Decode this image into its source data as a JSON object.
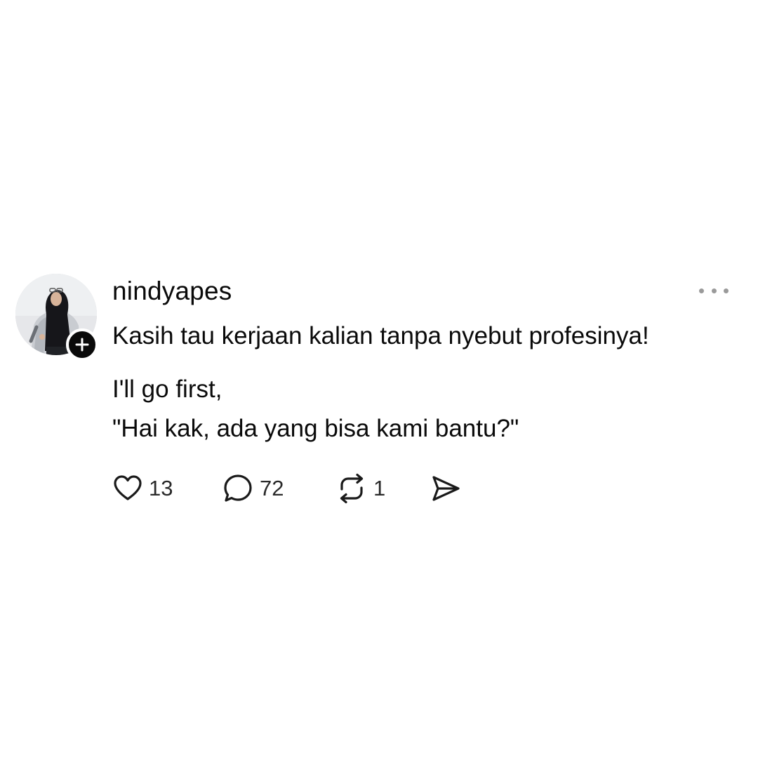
{
  "post": {
    "username": "nindyapes",
    "lines": [
      "Kasih tau kerjaan kalian tanpa nyebut profesinya!",
      "I'll go first,",
      "\"Hai kak, ada yang bisa kami bantu?\""
    ],
    "follow_badge_icon": "plus-icon",
    "more_icon": "more-horizontal-icon"
  },
  "actions": {
    "like": {
      "icon": "heart-icon",
      "count": "13"
    },
    "reply": {
      "icon": "comment-bubble-icon",
      "count": "72"
    },
    "repost": {
      "icon": "repost-icon",
      "count": "1"
    },
    "share": {
      "icon": "send-icon"
    }
  },
  "colors": {
    "text": "#0a0a0a",
    "muted": "#9a9a9a",
    "background": "#ffffff",
    "badge": "#0a0a0a"
  }
}
